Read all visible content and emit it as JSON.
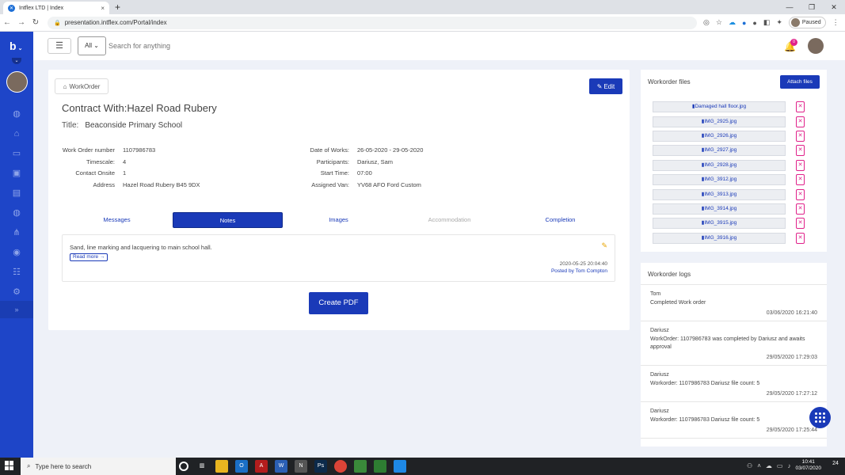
{
  "browser": {
    "tab_title": "Intflex LTD | Index",
    "url": "presentation.intflex.com/Portal/index",
    "profile_status": "Paused"
  },
  "sidebar": {
    "logo": "b",
    "icons": [
      "globe-icon",
      "basket-icon",
      "calendar-icon",
      "briefcase-icon",
      "toolbox-icon",
      "globe-icon",
      "hierarchy-icon",
      "bulb-icon",
      "group-icon",
      "settings-icon"
    ],
    "expand_label": "»"
  },
  "header": {
    "filter_selected": "All",
    "search_placeholder": "Search for anything",
    "notification_count": "0"
  },
  "workorder": {
    "tab_label": "WorkOrder",
    "edit_label": "Edit",
    "contract": "Contract With:Hazel Road Rubery",
    "title_label": "Title:",
    "title_value": "Beaconside Primary School",
    "left_details": [
      {
        "label": "Work Order number",
        "value": "1107986783"
      },
      {
        "label": "Timescale:",
        "value": "4"
      },
      {
        "label": "Contact Onsite",
        "value": "1"
      },
      {
        "label": "Address",
        "value": "Hazel Road Rubery B45 9DX"
      }
    ],
    "right_details": [
      {
        "label": "Date of Works:",
        "value": "26-05-2020 - 29-05-2020"
      },
      {
        "label": "Participants:",
        "value": "Dariusz, Sam"
      },
      {
        "label": "Start Time:",
        "value": "07:00"
      },
      {
        "label": "Assigned Van:",
        "value": "YV68 AFO Ford Custom"
      }
    ],
    "tabs": [
      "Messages",
      "Notes",
      "Images",
      "Accommodation",
      "Completion"
    ],
    "active_tab": "Notes",
    "note": {
      "text": "Sand, line marking and lacquering to main school hall.",
      "read_more": "Read more",
      "timestamp": "2020-05-25 20:04:40",
      "posted_by": "Posted by Tom Compton"
    },
    "create_pdf_label": "Create PDF"
  },
  "files": {
    "title": "Workorder files",
    "attach_label": "Attach files",
    "items": [
      "Damaged hall floor.jpg",
      "IMG_2925.jpg",
      "IMG_2926.jpg",
      "IMG_2927.jpg",
      "IMG_2928.jpg",
      "IMG_3912.jpg",
      "IMG_3913.jpg",
      "IMG_3914.jpg",
      "IMG_3915.jpg",
      "IMG_3916.jpg"
    ]
  },
  "logs": {
    "title": "Workorder logs",
    "items": [
      {
        "who": "Tom",
        "message": "Completed Work order",
        "time": "03/06/2020 16:21:40"
      },
      {
        "who": "Dariusz",
        "message": "WorkOrder: 1107986783 was completed by Dariusz and awaits approval",
        "time": "29/05/2020 17:29:03"
      },
      {
        "who": "Dariusz",
        "message": "Workorder: 1107986783 Dariusz file count: 5",
        "time": "29/05/2020 17:27:12"
      },
      {
        "who": "Dariusz",
        "message": "Workorder: 1107986783 Dariusz file count: 5",
        "time": "29/05/2020 17:25:44"
      }
    ]
  },
  "taskbar": {
    "search_placeholder": "Type here to search",
    "time": "10:41",
    "date": "03/07/2020",
    "notification_count": "24"
  },
  "colors": {
    "brand_blue": "#1a3ab8",
    "sidebar_blue": "#1e45c8",
    "danger_pink": "#e0208a",
    "page_bg": "#eef1f8"
  }
}
